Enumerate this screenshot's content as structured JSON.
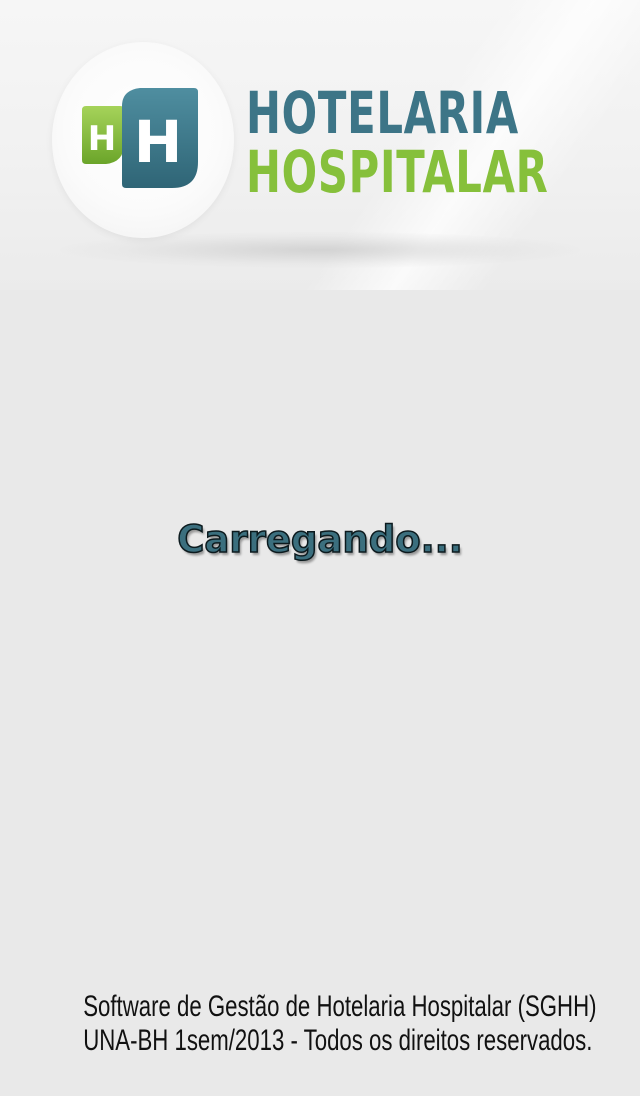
{
  "logo": {
    "line1": "HOTELARIA",
    "line2": "HOSPITALAR",
    "icon_letters": [
      "H",
      "H"
    ],
    "colors": {
      "teal": "#3d7587",
      "green": "#86c03b"
    }
  },
  "status": {
    "loading_text": "Carregando..."
  },
  "footer": {
    "line1": "Software de Gestão de Hotelaria Hospitalar (SGHH)",
    "line2": "UNA-BH 1sem/2013 - Todos os direitos reservados."
  }
}
